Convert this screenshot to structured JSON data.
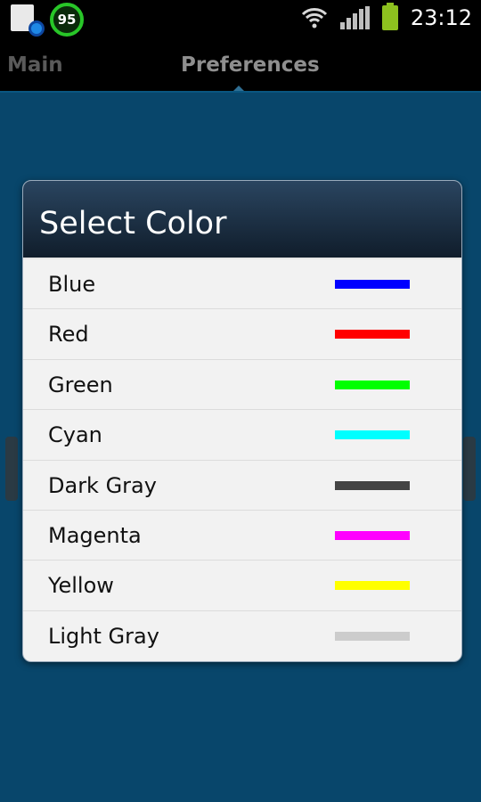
{
  "status_bar": {
    "battery_percent_badge": "95",
    "time": "23:12",
    "icons": [
      "sd-card-settings-icon",
      "battery-percent-icon",
      "wifi-icon",
      "signal-icon",
      "battery-icon"
    ]
  },
  "tabs": [
    {
      "label": "Main"
    },
    {
      "label": "Preferences"
    }
  ],
  "dialog": {
    "title": "Select Color",
    "options": [
      {
        "label": "Blue",
        "color": "#0000ff"
      },
      {
        "label": "Red",
        "color": "#ff0000"
      },
      {
        "label": "Green",
        "color": "#00ff00"
      },
      {
        "label": "Cyan",
        "color": "#00ffff"
      },
      {
        "label": "Dark Gray",
        "color": "#444444"
      },
      {
        "label": "Magenta",
        "color": "#ff00ff"
      },
      {
        "label": "Yellow",
        "color": "#ffff00"
      },
      {
        "label": "Light Gray",
        "color": "#cccccc"
      }
    ]
  }
}
